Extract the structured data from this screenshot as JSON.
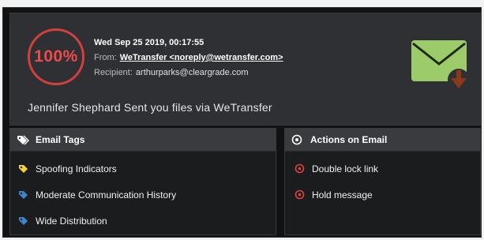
{
  "header": {
    "score": "100%",
    "date": "Wed Sep 25 2019, 00:17:55",
    "from_label": "From:",
    "from_value": "WeTransfer <noreply@wetransfer.com>",
    "recipient_label": "Recipient:",
    "recipient_value": "arthurparks@cleargrade.com",
    "subject": "Jennifer Shephard Sent you files via WeTransfer",
    "icon": "envelope-download-icon"
  },
  "tags_panel": {
    "title": "Email Tags",
    "icon": "tags-icon",
    "items": [
      {
        "label": "Spoofing Indicators",
        "icon": "tag-icon",
        "color": "#f2d33b"
      },
      {
        "label": "Moderate Communication History",
        "icon": "tag-icon",
        "color": "#3c83c9"
      },
      {
        "label": "Wide Distribution",
        "icon": "tag-icon",
        "color": "#3c83c9"
      }
    ]
  },
  "actions_panel": {
    "title": "Actions on Email",
    "icon": "target-icon",
    "items": [
      {
        "label": "Double lock link",
        "icon": "target-icon",
        "color": "#e0433f"
      },
      {
        "label": "Hold message",
        "icon": "target-icon",
        "color": "#e0433f"
      }
    ]
  },
  "colors": {
    "score_red": "#d23f3f",
    "envelope_green": "#9ccb6a",
    "download_arrow": "#8a3a1a"
  }
}
